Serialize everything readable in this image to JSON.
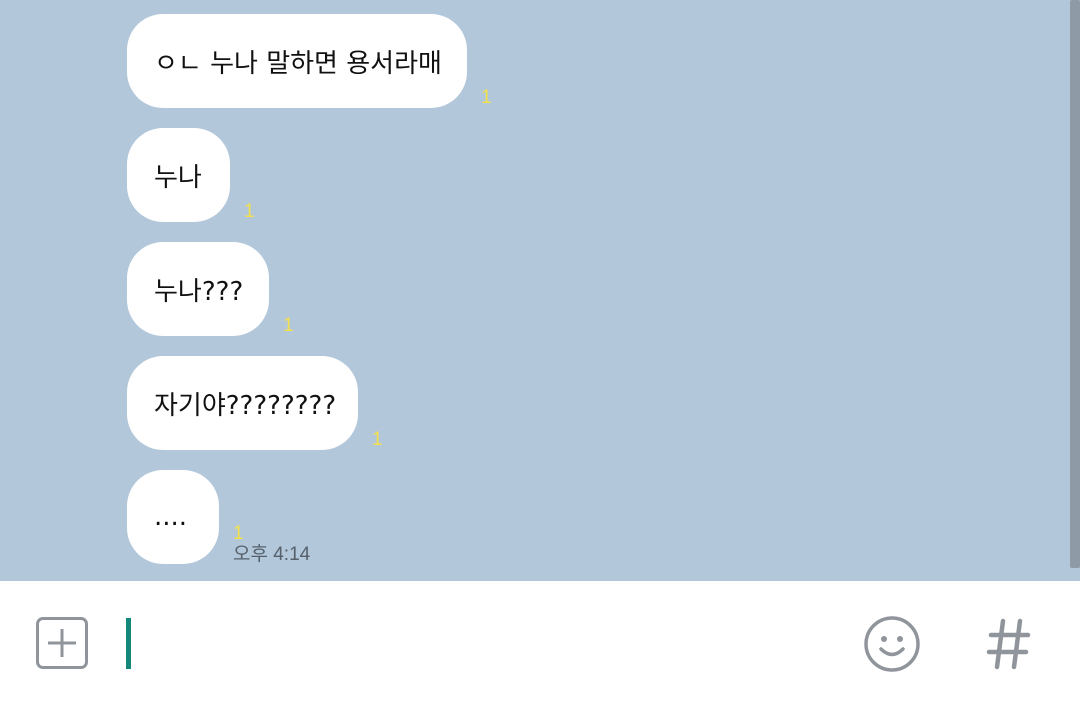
{
  "messages": [
    {
      "text": "ㅇㄴ 누나 말하면 용서라매",
      "unread": "1",
      "time": ""
    },
    {
      "text": "누나",
      "unread": "1",
      "time": ""
    },
    {
      "text": "누나???",
      "unread": "1",
      "time": ""
    },
    {
      "text": "자기야????????",
      "unread": "1",
      "time": ""
    },
    {
      "text": "....",
      "unread": "1",
      "time": "오후 4:14"
    }
  ],
  "input": {
    "value": "",
    "placeholder": ""
  },
  "icons": {
    "attach": "plus-square-icon",
    "emoji": "smiley-face-icon",
    "hashtag": "hashtag-icon"
  },
  "colors": {
    "chat_background": "#b2c7da",
    "bubble": "#ffffff",
    "unread_count": "#f4e04a",
    "caret": "#13887a",
    "icon": "#8f959b"
  }
}
